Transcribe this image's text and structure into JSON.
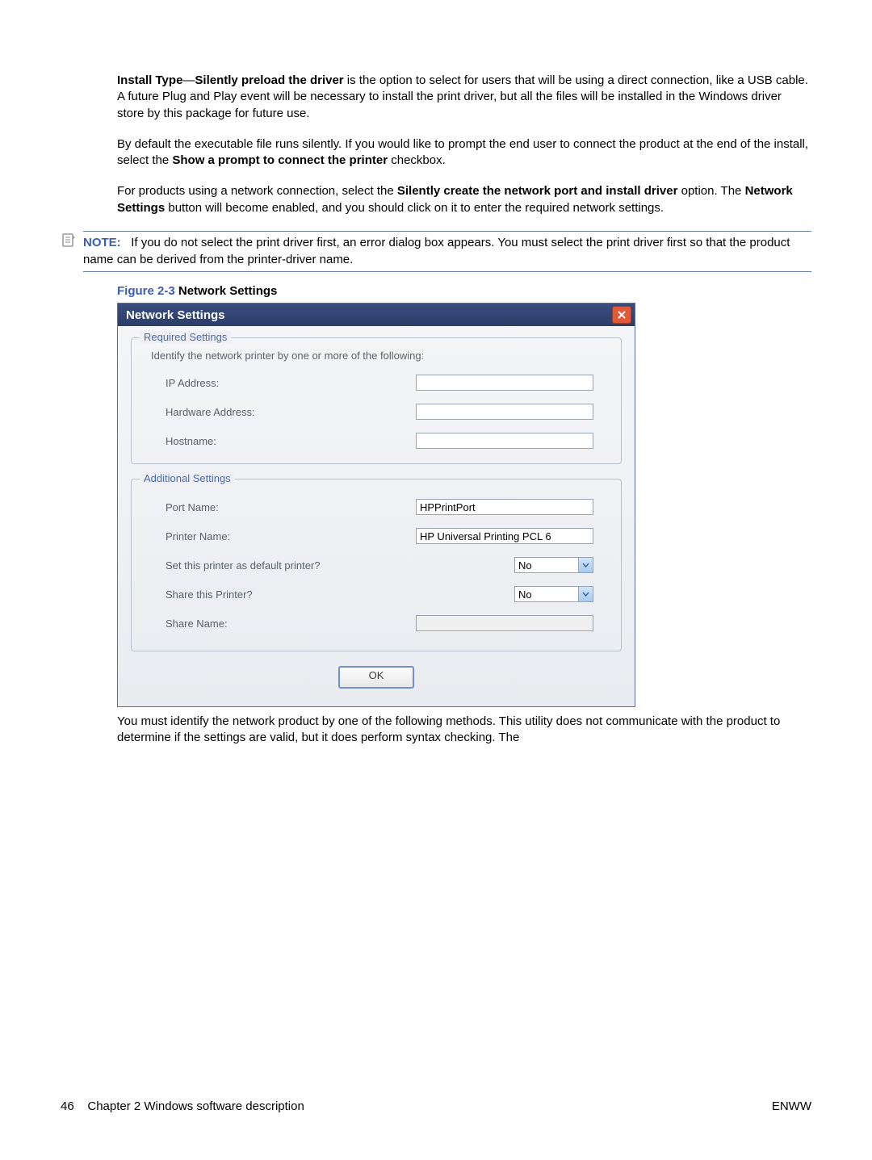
{
  "body": {
    "p1_a": "Install Type",
    "p1_dash": "—",
    "p1_b": "Silently preload the driver",
    "p1_c": " is the option to select for users that will be using a direct connection, like a USB cable. A future Plug and Play event will be necessary to install the print driver, but all the files will be installed in the Windows driver store by this package for future use.",
    "p2_a": "By default the executable file runs silently. If you would like to prompt the end user to connect the product at the end of the install, select the ",
    "p2_b": "Show a prompt to connect the printer",
    "p2_c": " checkbox.",
    "p3_a": "For products using a network connection, select the ",
    "p3_b": "Silently create the network port and install driver",
    "p3_c": " option. The ",
    "p3_d": "Network Settings",
    "p3_e": " button will become enabled, and you should click on it to enter the required network settings.",
    "note_label": "NOTE:",
    "note_text": "If you do not select the print driver first, an error dialog box appears. You must select the print driver first so that the product name can be derived from the printer-driver name.",
    "fig_label": "Figure 2-3",
    "fig_title": "  Network Settings",
    "after_fig": "You must identify the network product by one of the following methods. This utility does not communicate with the product to determine if the settings are valid, but it does perform syntax checking. The"
  },
  "dialog": {
    "title": "Network Settings",
    "required_legend": "Required Settings",
    "required_intro": "Identify the network printer by one or more of the following:",
    "ip_label": "IP Address:",
    "hw_label": "Hardware Address:",
    "host_label": "Hostname:",
    "additional_legend": "Additional Settings",
    "port_label": "Port Name:",
    "port_value": "HPPrintPort",
    "printer_label": "Printer Name:",
    "printer_value": "HP Universal Printing PCL 6",
    "default_label": "Set this printer as default printer?",
    "default_value": "No",
    "share_label": "Share this Printer?",
    "share_value": "No",
    "sharename_label": "Share Name:",
    "ok": "OK"
  },
  "footer": {
    "page": "46",
    "chapter": "Chapter 2   Windows software description",
    "right": "ENWW"
  }
}
